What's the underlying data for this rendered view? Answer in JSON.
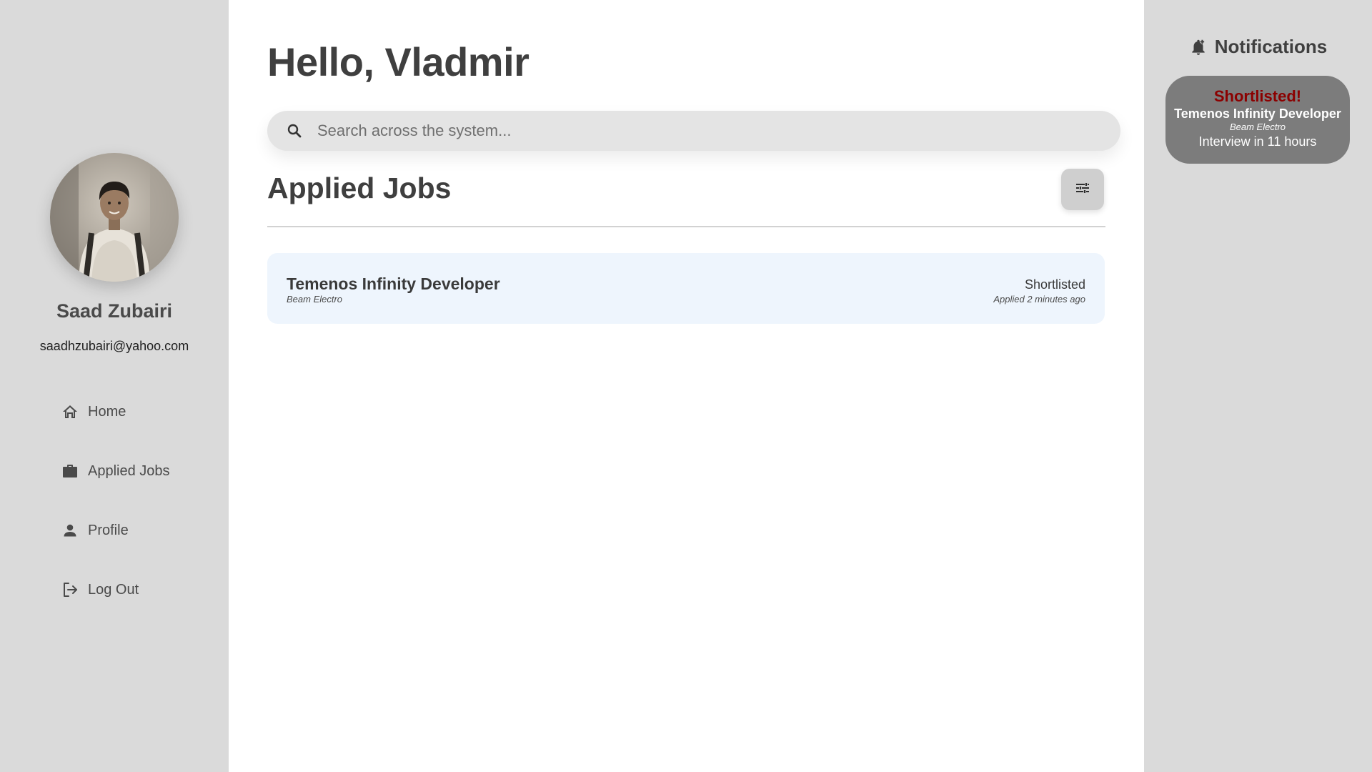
{
  "sidebar": {
    "user_name": "Saad Zubairi",
    "user_email": "saadhzubairi@yahoo.com",
    "nav": [
      {
        "label": "Home",
        "icon": "home-icon"
      },
      {
        "label": "Applied Jobs",
        "icon": "briefcase-icon"
      },
      {
        "label": "Profile",
        "icon": "person-icon"
      },
      {
        "label": "Log Out",
        "icon": "logout-icon"
      }
    ]
  },
  "main": {
    "greeting": "Hello, Vladmir",
    "search": {
      "placeholder": "Search across the system...",
      "value": "",
      "icon": "search-icon"
    },
    "section_title": "Applied Jobs",
    "filter_icon": "tune-sliders-icon",
    "jobs": [
      {
        "title": "Temenos Infinity Developer",
        "company": "Beam Electro",
        "status": "Shortlisted",
        "applied": "Applied 2 minutes ago"
      }
    ]
  },
  "notifications": {
    "title": "Notifications",
    "icon": "bell-add-icon",
    "items": [
      {
        "status": "Shortlisted!",
        "job": "Temenos Infinity Developer",
        "company": "Beam Electro",
        "detail": "Interview in 11 hours"
      }
    ]
  },
  "colors": {
    "sidebar_bg": "#dadada",
    "card_bg": "#eef5fd",
    "notification_bg": "#7c7c7c",
    "shortlisted_red": "#8b0000"
  }
}
